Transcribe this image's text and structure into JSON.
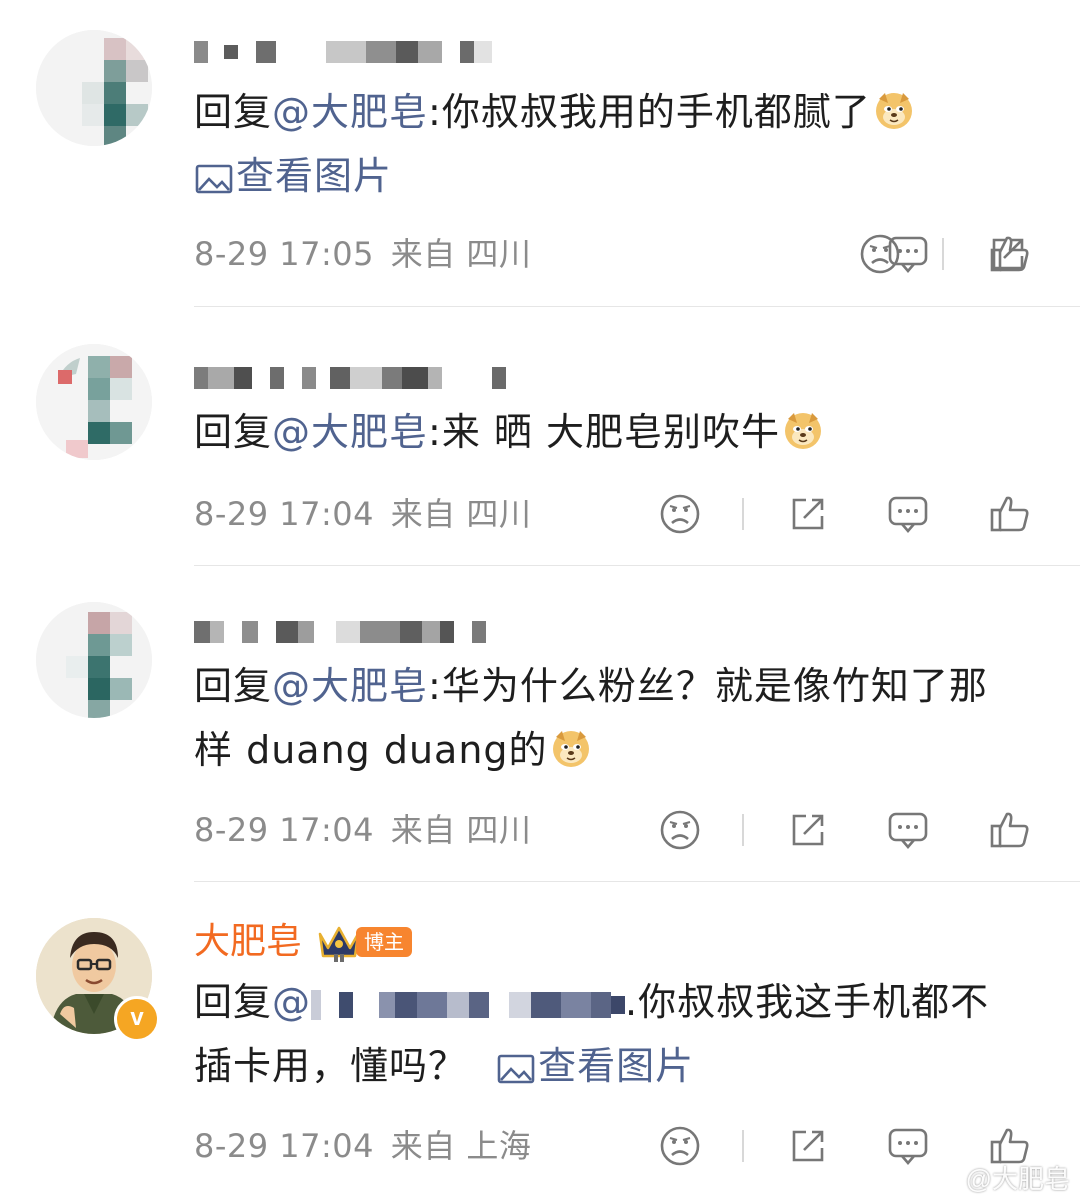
{
  "comments": [
    {
      "reply_prefix": "回复",
      "mention": "@大肥皂",
      "body": ":你叔叔我用的手机都腻了",
      "view_image": "查看图片",
      "date": "8-29 17:05",
      "location": "来自 四川"
    },
    {
      "reply_prefix": "回复",
      "mention": "@大肥皂",
      "body": ":来 晒 大肥皂别吹牛",
      "date": "8-29 17:04",
      "location": "来自 四川"
    },
    {
      "reply_prefix": "回复",
      "mention": "@大肥皂",
      "body": ":华为什么粉丝？就是像竹知了那样 duang duang的",
      "date": "8-29 17:04",
      "location": "来自 四川"
    },
    {
      "author": "大肥皂",
      "author_badge": "博主",
      "reply_prefix": "回复",
      "mention": "@",
      "body": ".你叔叔我这手机都不插卡用，懂吗？",
      "view_image": "查看图片",
      "date": "8-29 17:04",
      "location": "来自 上海",
      "verified_mark": "v"
    }
  ],
  "icons": {
    "dislike": "sad-face-icon",
    "repost": "repost-icon",
    "comment": "comment-bubble-icon",
    "like": "thumbs-up-icon",
    "emoji": "doge-emoji-icon",
    "image": "image-icon"
  },
  "colors": {
    "mention": "#50638f",
    "author": "#f26a21",
    "meta": "#8b8b8b",
    "badge": "#f7852f"
  },
  "watermark": "@大肥皂"
}
